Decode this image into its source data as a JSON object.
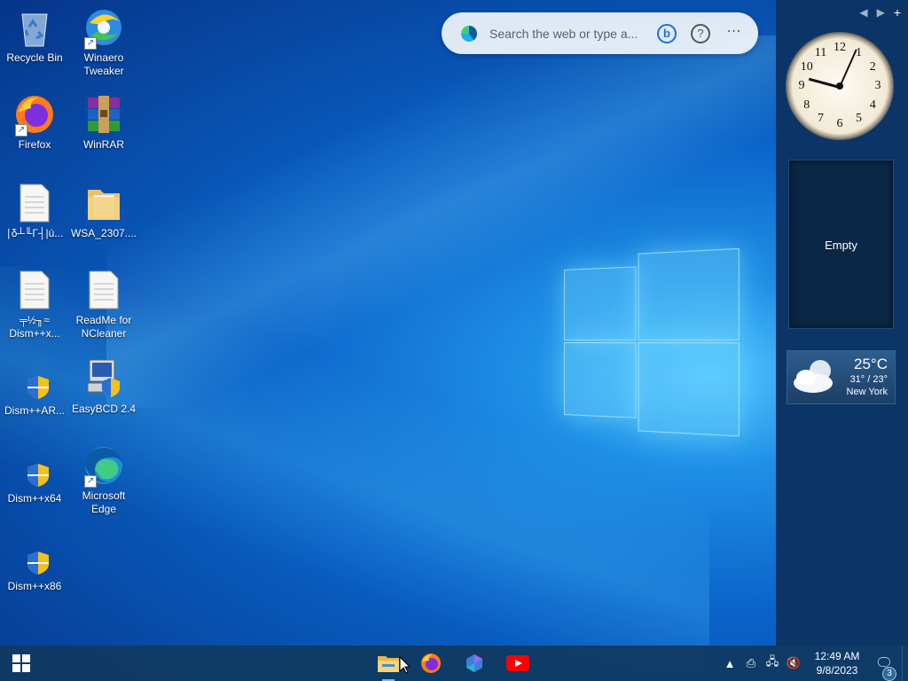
{
  "desktop": {
    "icons": [
      {
        "name": "recycle-bin",
        "label": "Recycle Bin"
      },
      {
        "name": "winaero-tweaker",
        "label": "Winaero Tweaker"
      },
      {
        "name": "firefox",
        "label": "Firefox"
      },
      {
        "name": "winrar",
        "label": "WinRAR"
      },
      {
        "name": "text-file-1",
        "label": "∣δ┴╙Γ┤|ú..."
      },
      {
        "name": "folder-wsa",
        "label": "WSA_2307...."
      },
      {
        "name": "text-file-2",
        "label": "╤½╖≈ Dism++x..."
      },
      {
        "name": "readme-ncleaner",
        "label": "ReadMe for NCleaner"
      },
      {
        "name": "dism-arm",
        "label": "Dism++AR..."
      },
      {
        "name": "easybcd",
        "label": "EasyBCD 2.4"
      },
      {
        "name": "dism-x64",
        "label": "Dism++x64"
      },
      {
        "name": "microsoft-edge",
        "label": "Microsoft Edge"
      },
      {
        "name": "dism-x86",
        "label": "Dism++x86"
      }
    ]
  },
  "search": {
    "placeholder": "Search the web or type a..."
  },
  "sidebar": {
    "clock_numbers": [
      "12",
      "1",
      "2",
      "3",
      "4",
      "5",
      "6",
      "7",
      "8",
      "9",
      "10",
      "11"
    ],
    "slideshow_text": "Empty",
    "weather": {
      "temp": "25°C",
      "range": "31° / 23°",
      "city": "New York"
    }
  },
  "taskbar": {
    "apps": [
      "file-explorer",
      "firefox",
      "copilot",
      "youtube"
    ],
    "time": "12:49 AM",
    "date": "9/8/2023",
    "notifications": "3"
  },
  "colors": {
    "desktop": "#0a63c8",
    "sidebar": "#0b3566",
    "taskbar": "#103a64"
  }
}
